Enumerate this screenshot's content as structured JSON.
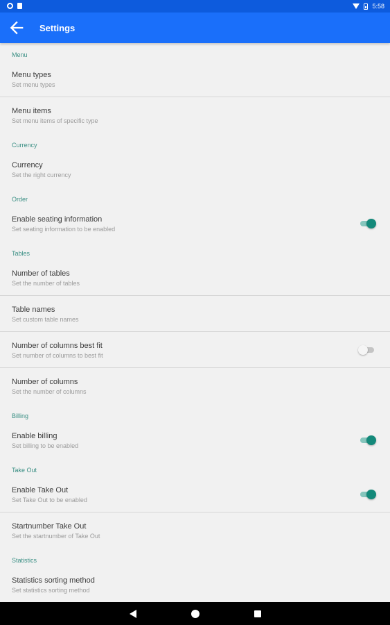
{
  "status_bar": {
    "time": "5:58"
  },
  "app_bar": {
    "title": "Settings"
  },
  "sections": {
    "menu": {
      "header": "Menu",
      "items": [
        {
          "title": "Menu types",
          "subtitle": "Set menu types"
        },
        {
          "title": "Menu items",
          "subtitle": "Set menu items of specific type"
        }
      ]
    },
    "currency": {
      "header": "Currency",
      "items": [
        {
          "title": "Currency",
          "subtitle": "Set the right currency"
        }
      ]
    },
    "order": {
      "header": "Order",
      "items": [
        {
          "title": "Enable seating information",
          "subtitle": "Set seating information to be enabled",
          "switch": true
        }
      ]
    },
    "tables": {
      "header": "Tables",
      "items": [
        {
          "title": "Number of tables",
          "subtitle": "Set the number of tables"
        },
        {
          "title": "Table names",
          "subtitle": "Set custom table names"
        },
        {
          "title": "Number of columns best fit",
          "subtitle": "Set number of columns to best fit",
          "switch": false
        },
        {
          "title": "Number of columns",
          "subtitle": "Set the number of columns"
        }
      ]
    },
    "billing": {
      "header": "Billing",
      "items": [
        {
          "title": "Enable billing",
          "subtitle": "Set billing to be enabled",
          "switch": true
        }
      ]
    },
    "take_out": {
      "header": "Take Out",
      "items": [
        {
          "title": "Enable Take Out",
          "subtitle": "Set Take Out to be enabled",
          "switch": true
        },
        {
          "title": "Startnumber Take Out",
          "subtitle": "Set the startnumber of Take Out"
        }
      ]
    },
    "statistics": {
      "header": "Statistics",
      "items": [
        {
          "title": "Statistics sorting method",
          "subtitle": "Set statistics sorting method"
        }
      ]
    }
  },
  "colors": {
    "status_bar": "#0d5bdd",
    "app_bar": "#1a6ffa",
    "accent": "#14897a",
    "section_header": "#3a8f84",
    "background": "#f1f1f1"
  },
  "icons": {
    "back": "arrow-back-icon",
    "nav": [
      "nav-back-icon",
      "nav-home-icon",
      "nav-recents-icon"
    ]
  }
}
